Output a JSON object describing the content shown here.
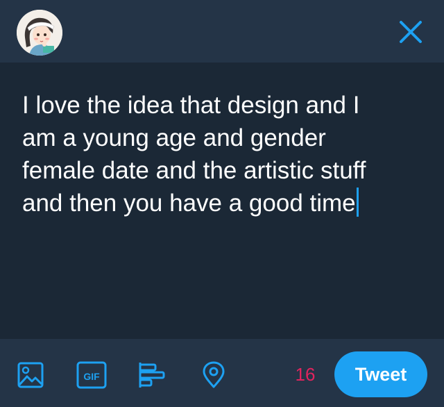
{
  "header": {
    "avatar_icon": "user-avatar-illustration",
    "close_icon": "close-x-icon"
  },
  "compose": {
    "lines": [
      "I love the idea that design and I",
      "am a young age and gender",
      "female date and the artistic stuff",
      "and then you have a good time"
    ]
  },
  "toolbar": {
    "icons": [
      "image-icon",
      "gif-icon",
      "poll-icon",
      "location-pin-icon"
    ],
    "gif_label": "GIF",
    "char_counter": "16",
    "tweet_label": "Tweet"
  },
  "colors": {
    "accent": "#1da1f2",
    "counter_warning": "#e0245e",
    "header_bg": "#243447",
    "body_bg": "#1b2836"
  }
}
